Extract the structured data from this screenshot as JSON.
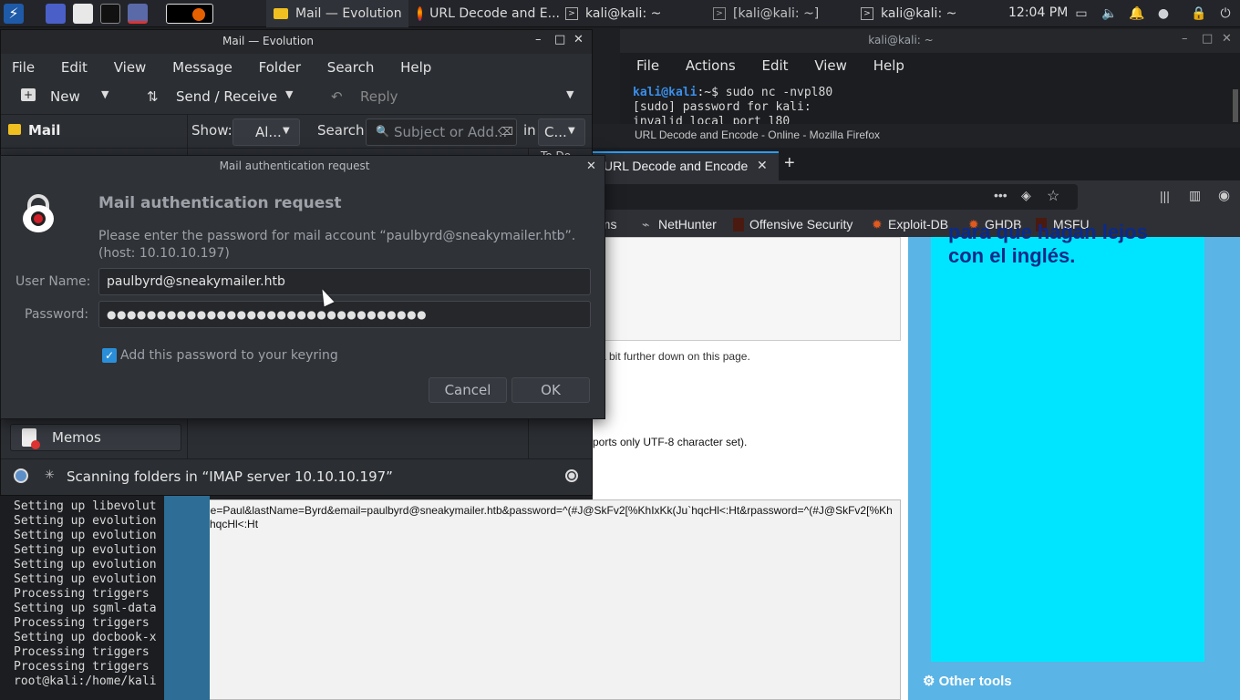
{
  "taskbar": {
    "tasks": [
      {
        "label": "Mail — Evolution",
        "icon": "mail-icon"
      },
      {
        "label": "URL Decode and E...",
        "icon": "firefox-icon"
      },
      {
        "label": "kali@kali: ~",
        "icon": "terminal-icon"
      },
      {
        "label": "[kali@kali: ~]",
        "icon": "terminal-icon"
      },
      {
        "label": "kali@kali: ~",
        "icon": "terminal-icon"
      }
    ],
    "clock": "12:04 PM"
  },
  "terminal_right": {
    "title": "kali@kali: ~",
    "menu": [
      "File",
      "Actions",
      "Edit",
      "View",
      "Help"
    ],
    "prompt_user": "kali@kali",
    "prompt_path": ":~$",
    "command": " sudo nc -nvpl80",
    "lines": [
      "[sudo] password for kali:",
      "invalid local port l80"
    ]
  },
  "firefox": {
    "title": "URL Decode and Encode - Online - Mozilla Firefox",
    "tab_label": "URL Decode and Encode",
    "bookmarks": [
      "ums",
      "NetHunter",
      "Offensive Security",
      "Exploit-DB",
      "GHDB",
      "MSFU"
    ],
    "hint_text": "a bit further down on this page.",
    "charset_text": "ports only UTF-8 character set).",
    "output_text": "firstName=Paul&lastName=Byrd&email=paulbyrd@sneakymailer.htb&password=^(#J@SkFv2[%KhIxKk(Ju`hqcHl<:Ht&rpassword=^(#J@SkFv2[%KhIxKk(Ju`hqcHl<:Ht",
    "ad_text_partial": "para que hagan lejos",
    "ad_text": "con el inglés.",
    "other_tools": "Other tools"
  },
  "evolution": {
    "title": "Mail — Evolution",
    "menu": [
      "File",
      "Edit",
      "View",
      "Message",
      "Folder",
      "Search",
      "Help"
    ],
    "toolbar": {
      "new": "New",
      "send_receive": "Send / Receive",
      "reply": "Reply"
    },
    "sidebar_title": "Mail",
    "show_label": "Show:",
    "show_value": "Al...",
    "search_label": "Search:",
    "search_placeholder": "Subject or Add...",
    "in_label": "in",
    "in_value": "C...",
    "column_partial": "To Do",
    "memos": "Memos",
    "status": "Scanning folders in “IMAP server 10.10.10.197”"
  },
  "dialog": {
    "window_title": "Mail authentication request",
    "heading": "Mail authentication request",
    "message_line1": "Please enter the password for mail account “paulbyrd@sneakymailer.htb”.",
    "message_line2": "(host: 10.10.10.197)",
    "username_label": "User Name:",
    "username_value": "paulbyrd@sneakymailer.htb",
    "password_label": "Password:",
    "password_value": "●●●●●●●●●●●●●●●●●●●●●●●●●●●●●●●●",
    "keyring_label": "Add this password to your keyring",
    "keyring_checked": true,
    "cancel": "Cancel",
    "ok": "OK"
  },
  "terminal_left": {
    "lines": [
      "Setting up libevolut",
      "Setting up evolution",
      "Setting up evolution",
      "Setting up evolution",
      "Setting up evolution",
      "Setting up evolution",
      "Processing triggers",
      "Setting up sgml-data",
      "Processing triggers",
      "Setting up docbook-x",
      "Processing triggers",
      "Processing triggers",
      "root@kali:/home/kali"
    ]
  },
  "colors": {
    "accent": "#2a9df4",
    "ad_bg": "#00e5ff",
    "ad_text": "#0b2a8a",
    "prompt_user": "#3b8eea"
  }
}
